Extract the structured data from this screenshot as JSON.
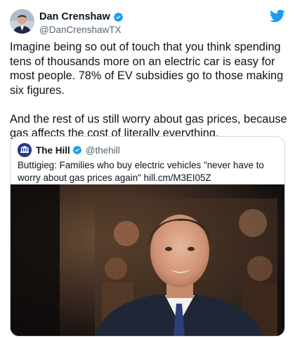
{
  "author": {
    "display_name": "Dan Crenshaw",
    "handle": "@DanCrenshawTX",
    "verified_icon": "verified-badge-icon"
  },
  "brand": {
    "logo_icon": "twitter-bird-icon",
    "color": "#1d9bf0"
  },
  "tweet": {
    "text": "Imagine being so out of touch that you think spending tens of thousands more on an electric car is easy for most people. 78% of EV subsidies go to those making six figures.\n\nAnd the rest of us still worry about gas prices, because gas affects the cost of literally everything."
  },
  "quote": {
    "display_name": "The Hill",
    "handle": "@thehill",
    "text": "Buttigieg: Families who buy electric vehicles \"never have to worry about gas prices again\" hill.cm/M3EI05Z",
    "avatar_color": "#27398a"
  }
}
